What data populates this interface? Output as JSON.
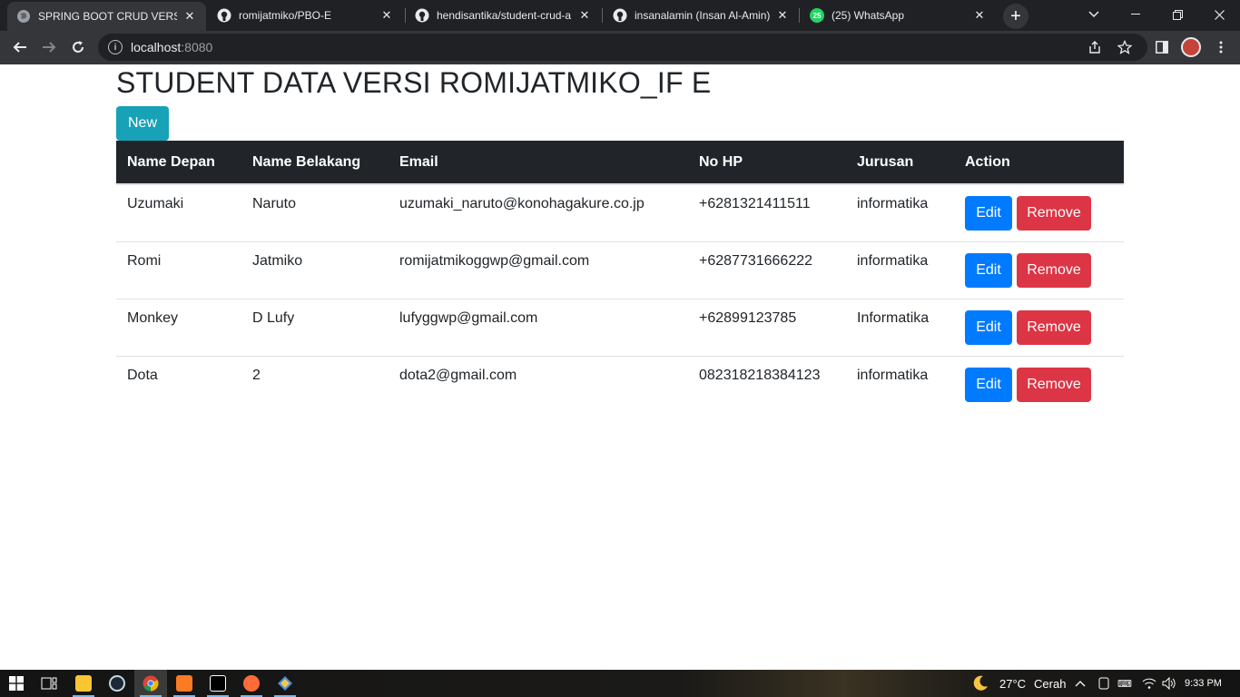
{
  "browser": {
    "tabs": [
      {
        "title": "SPRING BOOT CRUD VERSI R",
        "favicon": "globe-icon",
        "active": true
      },
      {
        "title": "romijatmiko/PBO-E",
        "favicon": "github-icon",
        "active": false
      },
      {
        "title": "hendisantika/student-crud-a",
        "favicon": "github-icon",
        "active": false
      },
      {
        "title": "insanalamin (Insan Al-Amin)",
        "favicon": "github-icon",
        "active": false
      },
      {
        "title": "(25) WhatsApp",
        "favicon": "whatsapp-icon",
        "active": false
      }
    ],
    "new_tab_symbol": "+",
    "url_host": "localhost",
    "url_port": ":8080",
    "whatsapp_badge": "25"
  },
  "page": {
    "title": "STUDENT DATA VERSI ROMIJATMIKO_IF E",
    "new_button": "New",
    "columns": [
      "Name Depan",
      "Name Belakang",
      "Email",
      "No HP",
      "Jurusan",
      "Action"
    ],
    "rows": [
      {
        "first": "Uzumaki",
        "last": "Naruto",
        "email": "uzumaki_naruto@konohagakure.co.jp",
        "phone": "+6281321411511",
        "major": "informatika"
      },
      {
        "first": "Romi",
        "last": "Jatmiko",
        "email": "romijatmikoggwp@gmail.com",
        "phone": "+6287731666222",
        "major": "informatika"
      },
      {
        "first": "Monkey",
        "last": "D Lufy",
        "email": "lufyggwp@gmail.com",
        "phone": "+62899123785",
        "major": "Informatika"
      },
      {
        "first": "Dota",
        "last": "2",
        "email": "dota2@gmail.com",
        "phone": "082318218384123",
        "major": "informatika"
      }
    ],
    "edit_label": "Edit",
    "remove_label": "Remove"
  },
  "taskbar": {
    "weather_temp": "27°C",
    "weather_desc": "Cerah",
    "time": "9:33 PM"
  },
  "colors": {
    "new_button": "#17a2b8",
    "edit_button": "#007bff",
    "remove_button": "#dc3545",
    "table_header": "#212529"
  }
}
